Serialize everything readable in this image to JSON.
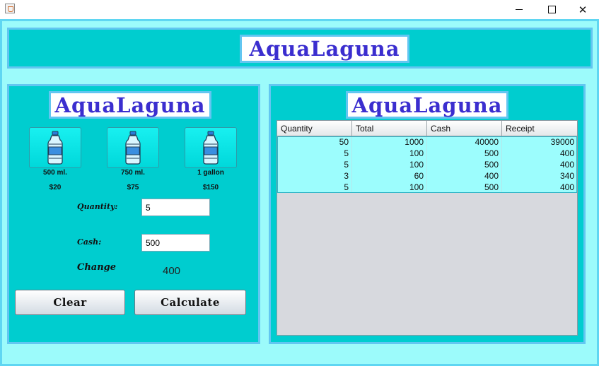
{
  "window": {
    "app_icon": "java-cup-icon",
    "controls": {
      "minimize": "—",
      "maximize": "☐",
      "close": "✕"
    }
  },
  "header": {
    "title": "AquaLaguna"
  },
  "left": {
    "title": "AquaLaguna",
    "products": [
      {
        "size": "500 ml.",
        "price": "$20",
        "icon": "water-bottle-icon"
      },
      {
        "size": "750 ml.",
        "price": "$75",
        "icon": "water-bottle-icon"
      },
      {
        "size": "1 gallon",
        "price": "$150",
        "icon": "water-bottle-icon"
      }
    ],
    "form": {
      "quantity_label": "Quantity:",
      "quantity_value": "5",
      "cash_label": "Cash:",
      "cash_value": "500",
      "change_label": "Change",
      "change_value": "400"
    },
    "buttons": {
      "clear": "Clear",
      "calculate": "Calculate"
    }
  },
  "right": {
    "title": "AquaLaguna",
    "table": {
      "columns": [
        "Quantity",
        "Total",
        "Cash",
        "Receipt"
      ],
      "rows": [
        [
          "50",
          "1000",
          "40000",
          "39000"
        ],
        [
          "5",
          "100",
          "500",
          "400"
        ],
        [
          "5",
          "100",
          "500",
          "400"
        ],
        [
          "3",
          "60",
          "400",
          "340"
        ],
        [
          "5",
          "100",
          "500",
          "400"
        ]
      ]
    }
  },
  "colors": {
    "frame_bg": "#9cfbfb",
    "panel_bg": "#00cdcf",
    "panel_border": "#62c6f1",
    "logo_text": "#3b2ecf",
    "table_row_bg": "#9cfdfd",
    "table_empty_bg": "#d7d9de"
  }
}
